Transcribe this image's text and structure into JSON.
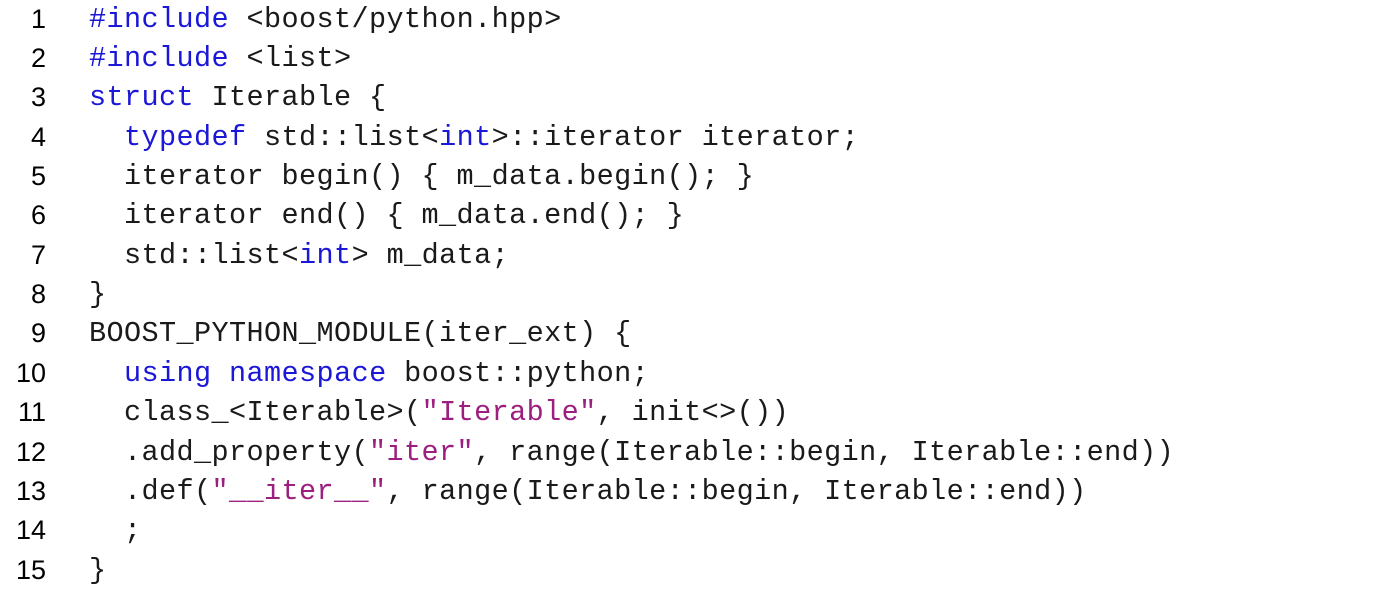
{
  "colors": {
    "keyword": "#1b17d6",
    "string": "#9c1f80",
    "text": "#1a1a1a",
    "background": "#ffffff"
  },
  "lines": [
    {
      "n": "1",
      "tokens": [
        {
          "t": "#include",
          "k": "kw"
        },
        {
          "t": " <boost/python.hpp>",
          "k": "plain"
        }
      ]
    },
    {
      "n": "2",
      "tokens": [
        {
          "t": "#include",
          "k": "kw"
        },
        {
          "t": " <list>",
          "k": "plain"
        }
      ]
    },
    {
      "n": "3",
      "tokens": [
        {
          "t": "struct",
          "k": "kw"
        },
        {
          "t": " Iterable {",
          "k": "plain"
        }
      ]
    },
    {
      "n": "4",
      "tokens": [
        {
          "t": "  ",
          "k": "plain"
        },
        {
          "t": "typedef",
          "k": "kw"
        },
        {
          "t": " std::list<",
          "k": "plain"
        },
        {
          "t": "int",
          "k": "kw"
        },
        {
          "t": ">::iterator iterator;",
          "k": "plain"
        }
      ]
    },
    {
      "n": "5",
      "tokens": [
        {
          "t": "  iterator begin() { m_data.begin(); }",
          "k": "plain"
        }
      ]
    },
    {
      "n": "6",
      "tokens": [
        {
          "t": "  iterator end() { m_data.end(); }",
          "k": "plain"
        }
      ]
    },
    {
      "n": "7",
      "tokens": [
        {
          "t": "  std::list<",
          "k": "plain"
        },
        {
          "t": "int",
          "k": "kw"
        },
        {
          "t": "> m_data;",
          "k": "plain"
        }
      ]
    },
    {
      "n": "8",
      "tokens": [
        {
          "t": "}",
          "k": "plain"
        }
      ]
    },
    {
      "n": "9",
      "tokens": [
        {
          "t": "BOOST_PYTHON_MODULE(iter_ext) {",
          "k": "plain"
        }
      ]
    },
    {
      "n": "10",
      "tokens": [
        {
          "t": "  ",
          "k": "plain"
        },
        {
          "t": "using",
          "k": "kw"
        },
        {
          "t": " ",
          "k": "plain"
        },
        {
          "t": "namespace",
          "k": "kw"
        },
        {
          "t": " boost::python;",
          "k": "plain"
        }
      ]
    },
    {
      "n": "11",
      "tokens": [
        {
          "t": "  class_<Iterable>(",
          "k": "plain"
        },
        {
          "t": "\"Iterable\"",
          "k": "str"
        },
        {
          "t": ", init<>())",
          "k": "plain"
        }
      ]
    },
    {
      "n": "12",
      "tokens": [
        {
          "t": "  .add_property(",
          "k": "plain"
        },
        {
          "t": "\"iter\"",
          "k": "str"
        },
        {
          "t": ", range(Iterable::begin, Iterable::end))",
          "k": "plain"
        }
      ]
    },
    {
      "n": "13",
      "tokens": [
        {
          "t": "  .def(",
          "k": "plain"
        },
        {
          "t": "\"__iter__\"",
          "k": "str"
        },
        {
          "t": ", range(Iterable::begin, Iterable::end))",
          "k": "plain"
        }
      ]
    },
    {
      "n": "14",
      "tokens": [
        {
          "t": "  ;",
          "k": "plain"
        }
      ]
    },
    {
      "n": "15",
      "tokens": [
        {
          "t": "}",
          "k": "plain"
        }
      ]
    }
  ]
}
